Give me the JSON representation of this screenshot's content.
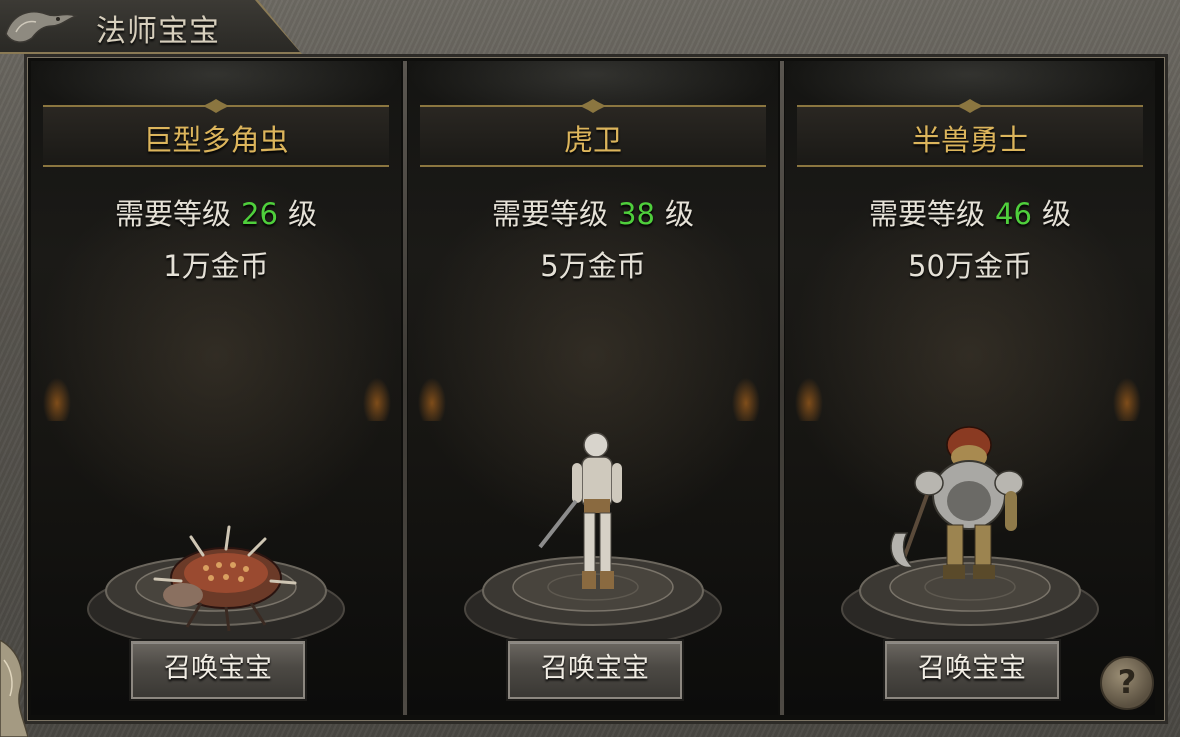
{
  "window": {
    "title": "法师宝宝"
  },
  "colors": {
    "name_gold": "#dcb55c",
    "level_green": "#4fcf3c",
    "text_light": "#e5e1d7"
  },
  "pets": [
    {
      "name": "巨型多角虫",
      "req_prefix": "需要等级",
      "level": "26",
      "level_suffix": "级",
      "cost": "1万金币",
      "button": "召唤宝宝",
      "model_icon": "spiked-beetle-icon"
    },
    {
      "name": "虎卫",
      "req_prefix": "需要等级",
      "level": "38",
      "level_suffix": "级",
      "cost": "5万金币",
      "button": "召唤宝宝",
      "model_icon": "skeleton-warrior-icon"
    },
    {
      "name": "半兽勇士",
      "req_prefix": "需要等级",
      "level": "46",
      "level_suffix": "级",
      "cost": "50万金币",
      "button": "召唤宝宝",
      "model_icon": "orc-warrior-icon"
    }
  ],
  "help": {
    "label": "?"
  }
}
